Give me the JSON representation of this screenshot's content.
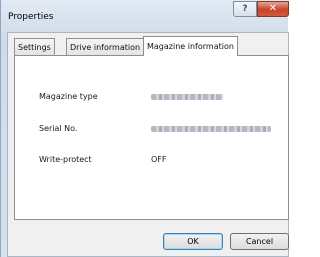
{
  "window": {
    "title": "Properties",
    "help_label": "?",
    "close_label": "✕"
  },
  "tabs": [
    {
      "label": "Settings",
      "active": false
    },
    {
      "label": "Drive information",
      "active": false
    },
    {
      "label": "Magazine information",
      "active": true
    }
  ],
  "fields": [
    {
      "label": "Magazine type",
      "value": ""
    },
    {
      "label": "Serial No.",
      "value": ""
    },
    {
      "label": "Write-protect",
      "value": "OFF"
    }
  ],
  "buttons": {
    "ok": "OK",
    "cancel": "Cancel"
  }
}
